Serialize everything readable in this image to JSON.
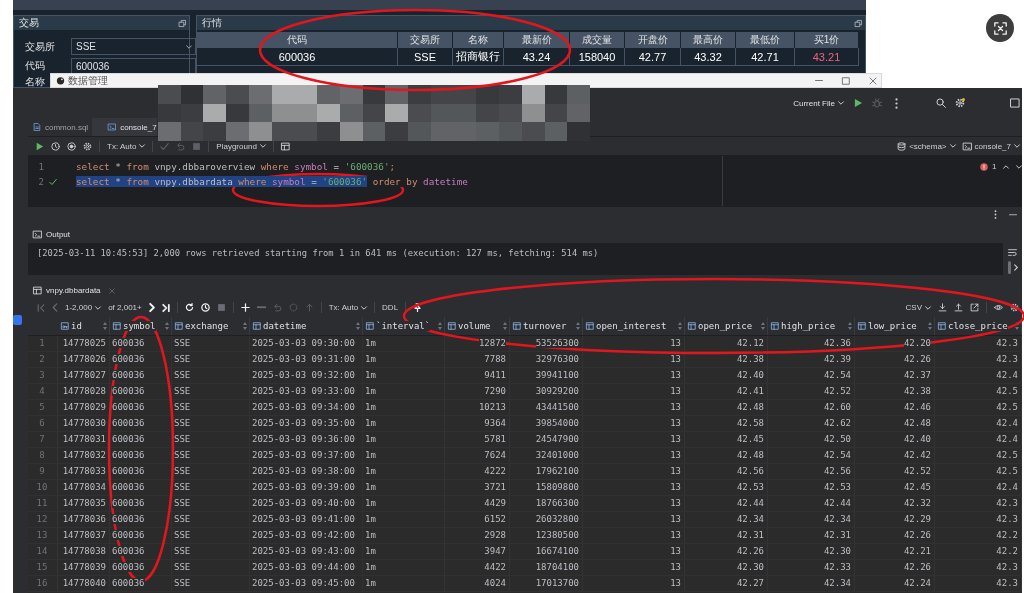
{
  "trading_app": {
    "trade_panel": {
      "title": "交易",
      "fields": [
        {
          "kind": "combo",
          "label": "交易所",
          "value": "SSE"
        },
        {
          "kind": "input",
          "label": "代码",
          "value": "600036"
        },
        {
          "kind": "label",
          "label": "名称"
        }
      ]
    },
    "quote_panel": {
      "title": "行情",
      "columns": [
        "代码",
        "交易所",
        "名称",
        "最新价",
        "成交量",
        "开盘价",
        "最高价",
        "最低价",
        "买1价"
      ],
      "rows": [
        {
          "cells": [
            {
              "text": "600036"
            },
            {
              "text": "SSE"
            },
            {
              "text": "招商银行"
            },
            {
              "text": "43.24"
            },
            {
              "text": "158040"
            },
            {
              "text": "42.77"
            },
            {
              "text": "43.32"
            },
            {
              "text": "42.71"
            },
            {
              "text": "43.21",
              "color": "#f0607e"
            }
          ]
        }
      ]
    }
  },
  "data_manager_window": {
    "title": "数据管理"
  },
  "ide": {
    "run_configuration": "Current File",
    "tabs": [
      {
        "label": "common.sql",
        "kind": "sql",
        "selected": false
      },
      {
        "label": "console_7",
        "kind": "console",
        "selected": true
      }
    ],
    "editor_toolbar": {
      "actions": [
        {
          "disabled": false
        },
        {
          "disabled": false
        },
        {
          "disabled": false
        },
        {
          "disabled": false
        },
        {
          "disabled": true
        },
        {
          "disabled": true
        },
        {
          "disabled": true
        },
        {
          "disabled": false
        }
      ],
      "transaction_mode": "Tx: Auto",
      "playground": "Playground",
      "schema": "<schema>",
      "session": "console_7"
    },
    "editor": {
      "lines": [
        {
          "number": "1",
          "executed": false,
          "segments": [
            {
              "selected": false,
              "tokens": [
                {
                  "kind": "keyword",
                  "text": "select"
                },
                {
                  "kind": "plain",
                  "text": " * "
                },
                {
                  "kind": "keyword",
                  "text": "from"
                },
                {
                  "kind": "plain",
                  "text": " vnpy.dbbaroverview "
                },
                {
                  "kind": "keyword",
                  "text": "where"
                },
                {
                  "kind": "column",
                  "text": " symbol"
                },
                {
                  "kind": "plain",
                  "text": " = "
                },
                {
                  "kind": "string",
                  "text": "'600036'"
                },
                {
                  "kind": "keyword",
                  "text": ";"
                }
              ]
            }
          ]
        },
        {
          "number": "2",
          "executed": true,
          "segments": [
            {
              "selected": true,
              "tokens": [
                {
                  "kind": "keyword",
                  "text": "select"
                },
                {
                  "kind": "plain",
                  "text": " * "
                },
                {
                  "kind": "keyword",
                  "text": "from"
                },
                {
                  "kind": "plain",
                  "text": " vnpy.dbbardata "
                },
                {
                  "kind": "keyword",
                  "text": "where"
                },
                {
                  "kind": "column",
                  "text": " symbol"
                },
                {
                  "kind": "plain",
                  "text": " = "
                },
                {
                  "kind": "string",
                  "text": "'600036'"
                }
              ]
            },
            {
              "selected": false,
              "tokens": [
                {
                  "kind": "keyword",
                  "text": " order by"
                },
                {
                  "kind": "column",
                  "text": " datetime"
                }
              ]
            }
          ]
        }
      ],
      "problem_count": "1"
    },
    "output": {
      "title": "Output",
      "lines": [
        "[2025-03-11 10:45:53] 2,000 rows retrieved starting from 1 in 641 ms (execution: 127 ms, fetching: 514 ms)"
      ]
    },
    "results": {
      "tab": "vnpy.dbbardata",
      "toolbar": {
        "actions": [
          {
            "disabled": true
          },
          {
            "disabled": true
          },
          {
            "disabled": false
          },
          {
            "disabled": false
          },
          {
            "disabled": false
          },
          {
            "disabled": false
          },
          {
            "disabled": true
          },
          {
            "disabled": false
          },
          {
            "disabled": true
          },
          {
            "disabled": true
          },
          {
            "disabled": true
          },
          {
            "disabled": true
          },
          {
            "disabled": false
          }
        ],
        "page_range": "1-2,000",
        "total": "of 2,001+",
        "transaction_mode": "Tx: Auto",
        "ddl": "DDL",
        "export_format": "CSV"
      },
      "columns": [
        {
          "name": "id",
          "numeric": true,
          "primary_key": true
        },
        {
          "name": "symbol",
          "numeric": false,
          "primary_key": false
        },
        {
          "name": "exchange",
          "numeric": false,
          "primary_key": false
        },
        {
          "name": "datetime",
          "numeric": false,
          "primary_key": false
        },
        {
          "name": "`interval`",
          "numeric": false,
          "primary_key": false
        },
        {
          "name": "volume",
          "numeric": true,
          "primary_key": false
        },
        {
          "name": "turnover",
          "numeric": true,
          "primary_key": false
        },
        {
          "name": "open_interest",
          "numeric": true,
          "primary_key": false
        },
        {
          "name": "open_price",
          "numeric": true,
          "primary_key": false
        },
        {
          "name": "high_price",
          "numeric": true,
          "primary_key": false
        },
        {
          "name": "low_price",
          "numeric": true,
          "primary_key": false
        },
        {
          "name": "close_price",
          "numeric": true,
          "primary_key": false
        }
      ],
      "rows": [
        {
          "number": "1",
          "cells": [
            "14778025",
            "600036",
            "SSE",
            "2025-03-03 09:30:00",
            "1m",
            "12872",
            "53526300",
            "13",
            "42.12",
            "42.36",
            "42.20",
            "42.3"
          ]
        },
        {
          "number": "2",
          "cells": [
            "14778026",
            "600036",
            "SSE",
            "2025-03-03 09:31:00",
            "1m",
            "7788",
            "32976300",
            "13",
            "42.38",
            "42.39",
            "42.26",
            "42.3"
          ]
        },
        {
          "number": "3",
          "cells": [
            "14778027",
            "600036",
            "SSE",
            "2025-03-03 09:32:00",
            "1m",
            "9411",
            "39941100",
            "13",
            "42.40",
            "42.54",
            "42.37",
            "42.4"
          ]
        },
        {
          "number": "4",
          "cells": [
            "14778028",
            "600036",
            "SSE",
            "2025-03-03 09:33:00",
            "1m",
            "7290",
            "30929200",
            "13",
            "42.41",
            "42.52",
            "42.38",
            "42.5"
          ]
        },
        {
          "number": "5",
          "cells": [
            "14778029",
            "600036",
            "SSE",
            "2025-03-03 09:34:00",
            "1m",
            "10213",
            "43441500",
            "13",
            "42.48",
            "42.60",
            "42.46",
            "42.5"
          ]
        },
        {
          "number": "6",
          "cells": [
            "14778030",
            "600036",
            "SSE",
            "2025-03-03 09:35:00",
            "1m",
            "9364",
            "39854000",
            "13",
            "42.58",
            "42.62",
            "42.48",
            "42.4"
          ]
        },
        {
          "number": "7",
          "cells": [
            "14778031",
            "600036",
            "SSE",
            "2025-03-03 09:36:00",
            "1m",
            "5781",
            "24547900",
            "13",
            "42.45",
            "42.50",
            "42.40",
            "42.4"
          ]
        },
        {
          "number": "8",
          "cells": [
            "14778032",
            "600036",
            "SSE",
            "2025-03-03 09:37:00",
            "1m",
            "7624",
            "32401000",
            "13",
            "42.48",
            "42.54",
            "42.42",
            "42.5"
          ]
        },
        {
          "number": "9",
          "cells": [
            "14778033",
            "600036",
            "SSE",
            "2025-03-03 09:38:00",
            "1m",
            "4222",
            "17962100",
            "13",
            "42.56",
            "42.56",
            "42.52",
            "42.5"
          ]
        },
        {
          "number": "10",
          "cells": [
            "14778034",
            "600036",
            "SSE",
            "2025-03-03 09:39:00",
            "1m",
            "3721",
            "15809800",
            "13",
            "42.53",
            "42.53",
            "42.45",
            "42.4"
          ]
        },
        {
          "number": "11",
          "cells": [
            "14778035",
            "600036",
            "SSE",
            "2025-03-03 09:40:00",
            "1m",
            "4429",
            "18766300",
            "13",
            "42.44",
            "42.44",
            "42.32",
            "42.3"
          ]
        },
        {
          "number": "12",
          "cells": [
            "14778036",
            "600036",
            "SSE",
            "2025-03-03 09:41:00",
            "1m",
            "6152",
            "26032800",
            "13",
            "42.34",
            "42.34",
            "42.29",
            "42.3"
          ]
        },
        {
          "number": "13",
          "cells": [
            "14778037",
            "600036",
            "SSE",
            "2025-03-03 09:42:00",
            "1m",
            "2928",
            "12380500",
            "13",
            "42.31",
            "42.31",
            "42.26",
            "42.2"
          ]
        },
        {
          "number": "14",
          "cells": [
            "14778038",
            "600036",
            "SSE",
            "2025-03-03 09:43:00",
            "1m",
            "3947",
            "16674100",
            "13",
            "42.26",
            "42.30",
            "42.21",
            "42.2"
          ]
        },
        {
          "number": "15",
          "cells": [
            "14778039",
            "600036",
            "SSE",
            "2025-03-03 09:44:00",
            "1m",
            "4422",
            "18704100",
            "13",
            "42.30",
            "42.33",
            "42.26",
            "42.3"
          ]
        },
        {
          "number": "16",
          "cells": [
            "14778040",
            "600036",
            "SSE",
            "2025-03-03 09:45:00",
            "1m",
            "4024",
            "17013700",
            "13",
            "42.27",
            "42.34",
            "42.24",
            "42.3"
          ]
        }
      ]
    }
  },
  "annotations": [
    {
      "kind": "ellipse",
      "color": "#e3161e"
    },
    {
      "kind": "ellipse",
      "color": "#e3161e"
    },
    {
      "kind": "ellipse",
      "color": "#e3161e"
    },
    {
      "kind": "ellipse",
      "color": "#e3161e"
    }
  ]
}
